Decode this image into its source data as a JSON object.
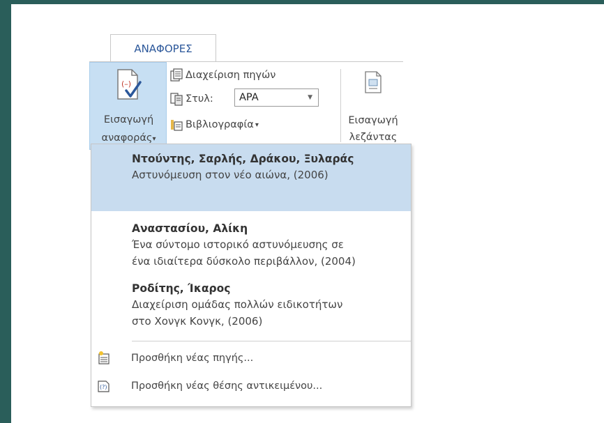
{
  "ribbon": {
    "tab_label": "ΑΝΑΦΟΡΕΣ",
    "insert_citation": {
      "line1": "Εισαγωγή",
      "line2": "αναφοράς",
      "arrow": "▾"
    },
    "manage_sources": "Διαχείριση πηγών",
    "style_label": "Στυλ:",
    "style_value": "APA",
    "bibliography": "Βιβλιογραφία",
    "bibliography_arrow": "▾",
    "insert_caption": {
      "line1": "Εισαγωγή",
      "line2": "λεζάντας"
    }
  },
  "dropdown": {
    "sources": [
      {
        "author": "Ντούντης, Σαρλής, Δράκου, Ξυλαράς",
        "title_lines": [
          "Αστυνόμευση στον νέο αιώνα, (2006)"
        ],
        "highlighted": true
      },
      {
        "author": "Αναστασίου, Αλίκη",
        "title_lines": [
          "Ένα σύντομο ιστορικό αστυνόμευσης σε",
          "ένα ιδιαίτερα δύσκολο περιβάλλον, (2004)"
        ],
        "highlighted": false
      },
      {
        "author": "Ροδίτης, Ίκαρος",
        "title_lines": [
          "Διαχείριση ομάδας πολλών ειδικοτήτων",
          "στο Χονγκ Κονγκ, (2006)"
        ],
        "highlighted": false
      }
    ],
    "add_new_source": "Προσθήκη νέας πηγής...",
    "add_placeholder": "Προσθήκη νέας θέσης αντικειμένου..."
  },
  "colors": {
    "background": "#2a5e5a",
    "accent": "#2b579a",
    "highlight": "#c8dcef"
  }
}
